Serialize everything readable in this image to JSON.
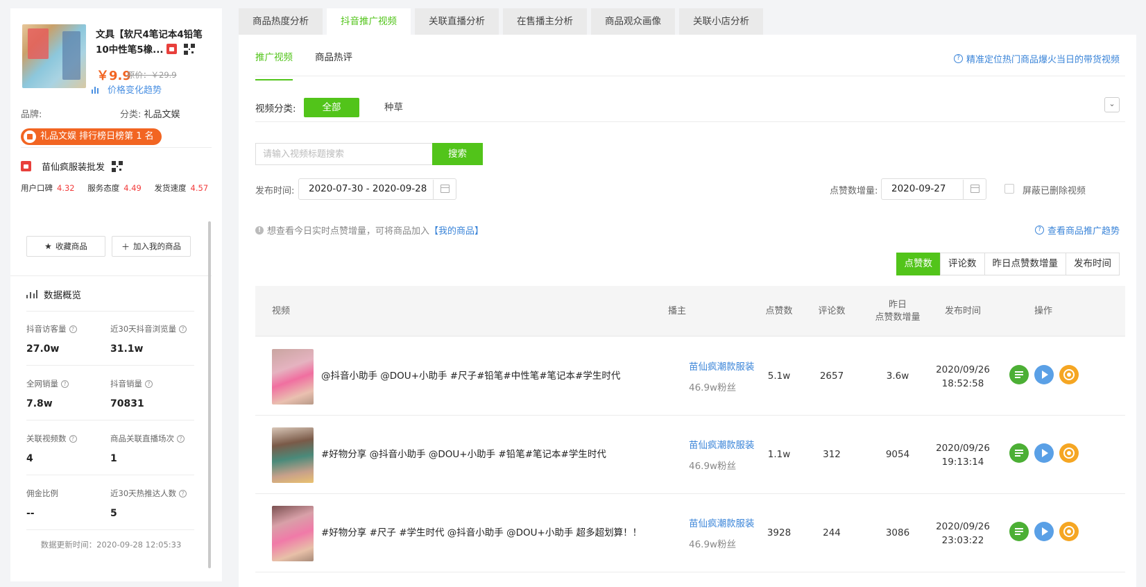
{
  "product": {
    "title_line1": "文具【软尺4笔记本4铅笔",
    "title_line2": "10中性笔5橡...",
    "price": "￥9.9",
    "original_price": "原价：￥29.9",
    "price_trend_label": "价格变化趋势",
    "brand_label": "品牌:",
    "brand_value": "",
    "category_label": "分类:",
    "category_value": "礼品文娱",
    "rank_badge": "礼品文娱 排行榜日榜第 1 名"
  },
  "shop": {
    "name": "苗仙疯服装批发",
    "scores": [
      {
        "label": "用户口碑",
        "value": "4.32"
      },
      {
        "label": "服务态度",
        "value": "4.49"
      },
      {
        "label": "发货速度",
        "value": "4.57"
      }
    ]
  },
  "actions": {
    "favorite": "收藏商品",
    "add_mine": "加入我的商品"
  },
  "overview": {
    "title": "数据概览",
    "metrics": [
      {
        "label": "抖音访客量",
        "value": "27.0w",
        "help": true
      },
      {
        "label": "近30天抖音浏览量",
        "value": "31.1w",
        "help": true
      },
      {
        "label": "全网销量",
        "value": "7.8w",
        "help": true
      },
      {
        "label": "抖音销量",
        "value": "70831",
        "help": true
      },
      {
        "label": "关联视频数",
        "value": "4",
        "help": true
      },
      {
        "label": "商品关联直播场次",
        "value": "1",
        "help": true
      },
      {
        "label": "佣金比例",
        "value": "--",
        "help": false
      },
      {
        "label": "近30天热推达人数",
        "value": "5",
        "help": true
      }
    ],
    "updated": "数据更新时间：2020-09-28 12:05:33"
  },
  "tabs": [
    "商品热度分析",
    "抖音推广视频",
    "关联直播分析",
    "在售播主分析",
    "商品观众画像",
    "关联小店分析"
  ],
  "active_tab": 1,
  "subtabs": [
    "推广视频",
    "商品热评"
  ],
  "hint_link": "精准定位热门商品爆火当日的带货视频",
  "filters": {
    "category_label": "视频分类:",
    "category_all": "全部",
    "category_zc": "种草",
    "search_placeholder": "请输入视频标题搜索",
    "search_btn": "搜索",
    "publish_label": "发布时间:",
    "publish_range": "2020-07-30 - 2020-09-28",
    "likes_label": "点赞数增量:",
    "likes_date": "2020-09-27",
    "hide_deleted": "屏蔽已删除视频"
  },
  "tip": {
    "text": "想查看今日实时点赞增量，可将商品加入",
    "link": "【我的商品】",
    "trend_link": "查看商品推广趋势"
  },
  "sort": [
    "点赞数",
    "评论数",
    "昨日点赞数增量",
    "发布时间"
  ],
  "table": {
    "headers": {
      "video": "视频",
      "anchor": "播主",
      "likes": "点赞数",
      "comments": "评论数",
      "inc_line1": "昨日",
      "inc_line2": "点赞数增量",
      "time": "发布时间",
      "ops": "操作"
    },
    "rows": [
      {
        "title": "@抖音小助手 @DOU+小助手 #尺子#铅笔#中性笔#笔记本#学生时代",
        "anchor": "苗仙疯潮款服装",
        "fans": "46.9w粉丝",
        "likes": "5.1w",
        "comments": "2657",
        "inc": "3.6w",
        "date": "2020/09/26",
        "time": "18:52:58"
      },
      {
        "title": "#好物分享 @抖音小助手 @DOU+小助手 #铅笔#笔记本#学生时代",
        "anchor": "苗仙疯潮款服装",
        "fans": "46.9w粉丝",
        "likes": "1.1w",
        "comments": "312",
        "inc": "9054",
        "date": "2020/09/26",
        "time": "19:13:14"
      },
      {
        "title": "#好物分享 #尺子 #学生时代 @抖音小助手 @DOU+小助手 超多超划算！！",
        "anchor": "苗仙疯潮款服装",
        "fans": "46.9w粉丝",
        "likes": "3928",
        "comments": "244",
        "inc": "3086",
        "date": "2020/09/26",
        "time": "23:03:22"
      }
    ]
  }
}
